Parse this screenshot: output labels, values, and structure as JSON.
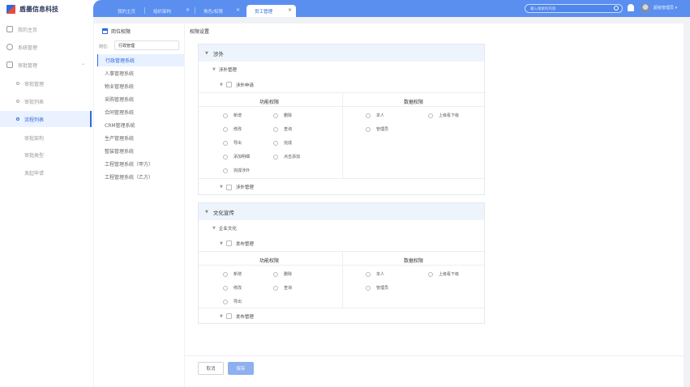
{
  "brand": {
    "name": "盾墨信息科技"
  },
  "nav": {
    "items": [
      {
        "label": "我的主页"
      },
      {
        "label": "系统管理"
      },
      {
        "label": "审批管理"
      }
    ],
    "sub": [
      {
        "label": "审批管理"
      },
      {
        "label": "审批列表"
      },
      {
        "label": "流程列表"
      }
    ],
    "leaves": [
      {
        "label": "审批架构"
      },
      {
        "label": "审批类型"
      },
      {
        "label": "发起申请"
      }
    ]
  },
  "tabs": [
    {
      "label": "我的主页"
    },
    {
      "label": "组织架构"
    },
    {
      "label": "角色/权限"
    },
    {
      "label": "员工管理"
    }
  ],
  "search": {
    "placeholder": "输入搜索的内容"
  },
  "user": {
    "name": "超级管理员"
  },
  "left_panel": {
    "title": "岗位权限",
    "position_label": "岗位:",
    "position_value": "行政管理",
    "systems": [
      "行政管理系统",
      "人事管理系统",
      "物业管理系统",
      "采购管理系统",
      "合同管理系统",
      "CRM管理系统",
      "生产管理系统",
      "整装管理系统",
      "工程管理系统（甲方）",
      "工程管理系统（乙方）"
    ]
  },
  "right_panel": {
    "title": "权限设置",
    "func_header": "功能权限",
    "data_header": "数据权限",
    "card1": {
      "title": "涉外",
      "group": "涉外管理",
      "item1": "涉外申请",
      "item2": "涉外管理",
      "func_perms": [
        "新增",
        "删除",
        "修改",
        "查询",
        "导出",
        "完成",
        "添加明细",
        "点击添加",
        "完成涉外"
      ],
      "data_perms": [
        "本人",
        "上级看下级",
        "管理员"
      ]
    },
    "card2": {
      "title": "文化宣传",
      "group": "企业文化",
      "item1": "发布管理",
      "item2": "发布管理",
      "func_perms": [
        "新增",
        "删除",
        "修改",
        "查询",
        "导出"
      ],
      "data_perms": [
        "本人",
        "上级看下级",
        "管理员"
      ]
    }
  },
  "footer": {
    "cancel": "取消",
    "save": "保存"
  },
  "colors": {
    "accent": "#2d6bde",
    "topbar": "#5a8ff0"
  }
}
